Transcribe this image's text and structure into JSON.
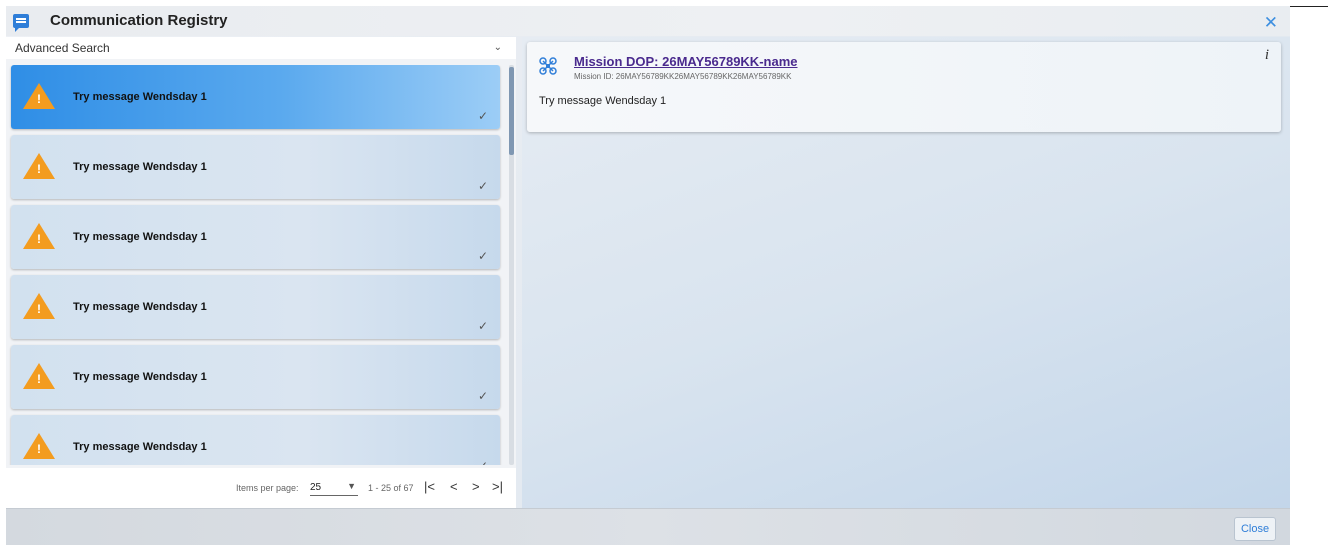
{
  "header": {
    "title": "Communication Registry",
    "app_icon": "chat-bubble-icon",
    "close_icon": "close-icon"
  },
  "search": {
    "label": "Advanced Search"
  },
  "messages": [
    {
      "text": "Try message Wendsday 1",
      "selected": true
    },
    {
      "text": "Try message Wendsday 1",
      "selected": false
    },
    {
      "text": "Try message Wendsday 1",
      "selected": false
    },
    {
      "text": "Try message Wendsday 1",
      "selected": false
    },
    {
      "text": "Try message Wendsday 1",
      "selected": false
    },
    {
      "text": "Try message Wendsday 1",
      "selected": false
    }
  ],
  "paginator": {
    "items_per_page_label": "Items per page:",
    "page_size": "25",
    "range": "1 - 25 of 67",
    "first": "|<",
    "prev": "<",
    "next": ">",
    "last": ">|"
  },
  "detail": {
    "mission_title": "Mission DOP: 26MAY56789KK-name",
    "mission_id": "Mission ID: 26MAY56789KK26MAY56789KK26MAY56789KK",
    "message": "Try message Wendsday 1",
    "info_glyph": "i"
  },
  "footer": {
    "close_label": "Close"
  },
  "colors": {
    "accent": "#2f7ed8",
    "warning": "#f39c1f",
    "selected": "#2f8ee6",
    "link": "#4a2a8e"
  }
}
